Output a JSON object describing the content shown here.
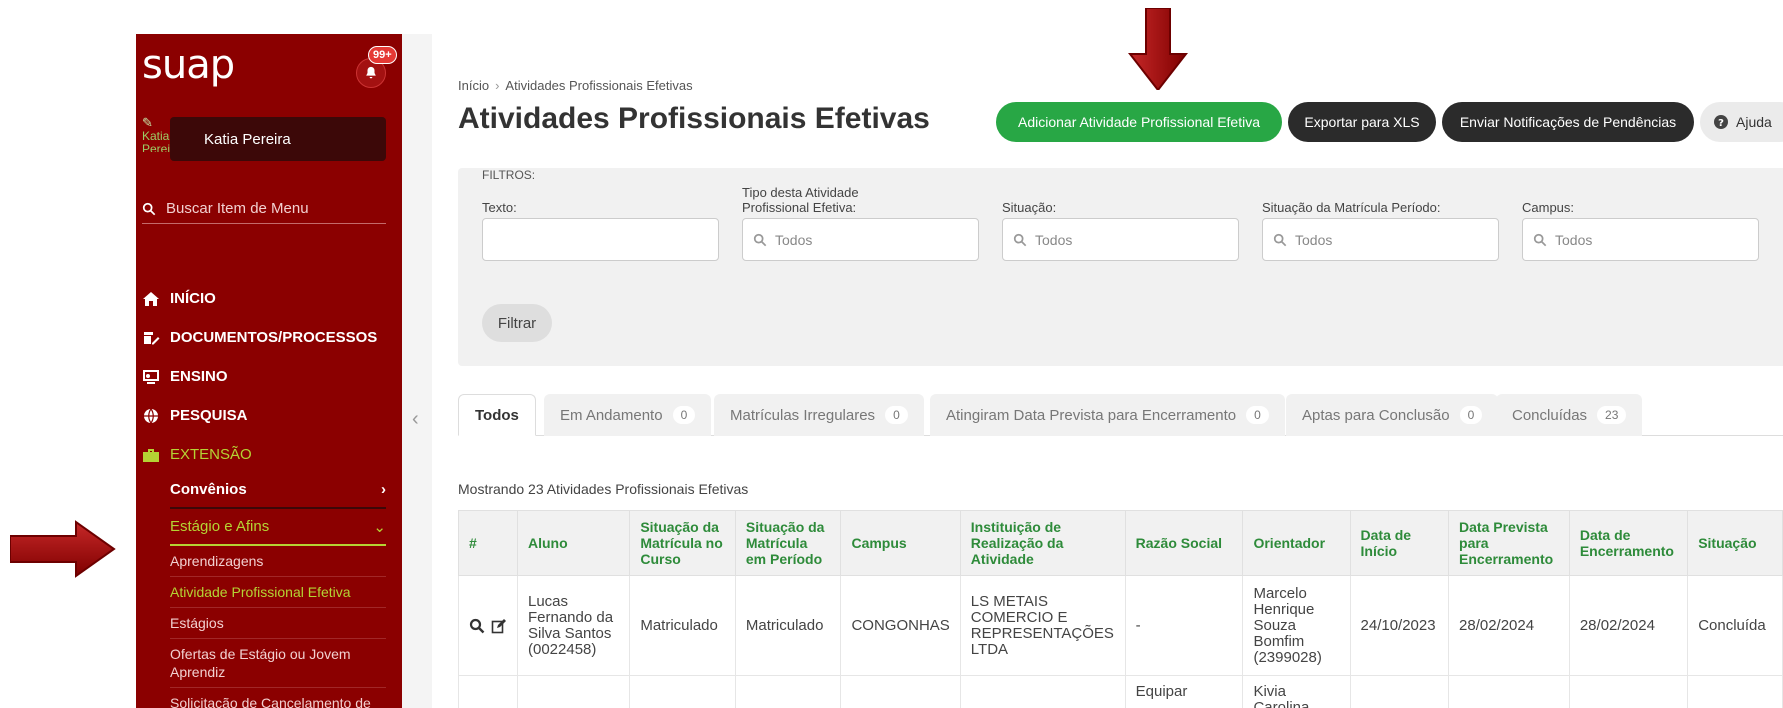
{
  "sidebar": {
    "logo": "suap",
    "notification_badge": "99+",
    "avatar_alt": "Katia Pereir",
    "user_name": "Katia Pereira",
    "search_placeholder": "Buscar Item de Menu",
    "menu": [
      {
        "label": "INÍCIO",
        "icon": "home-icon"
      },
      {
        "label": "DOCUMENTOS/PROCESSOS",
        "icon": "document-edit-icon"
      },
      {
        "label": "ENSINO",
        "icon": "teaching-icon"
      },
      {
        "label": "PESQUISA",
        "icon": "globe-icon"
      },
      {
        "label": "EXTENSÃO",
        "icon": "extension-icon"
      }
    ],
    "submenu": {
      "convenios": "Convênios",
      "estagio": "Estágio e Afins",
      "items": [
        "Aprendizagens",
        "Atividade Profissional Efetiva",
        "Estágios",
        "Ofertas de Estágio ou Jovem Aprendiz",
        "Solicitação de Cancelamento de Encerramento de Estágios e Afins"
      ]
    }
  },
  "breadcrumb": {
    "home": "Início",
    "current": "Atividades Profissionais Efetivas"
  },
  "page_title": "Atividades Profissionais Efetivas",
  "actions": {
    "add": "Adicionar Atividade Profissional Efetiva",
    "export": "Exportar para XLS",
    "notify": "Enviar Notificações de Pendências",
    "help": "Ajuda"
  },
  "filters": {
    "label": "FILTROS:",
    "texto": "Texto:",
    "tipo": "Tipo desta Atividade Profissional Efetiva:",
    "situacao": "Situação:",
    "situacao_matricula": "Situação da Matrícula Período:",
    "campus": "Campus:",
    "placeholder": "Todos",
    "submit": "Filtrar"
  },
  "tabs": [
    {
      "label": "Todos",
      "count": ""
    },
    {
      "label": "Em Andamento",
      "count": "0"
    },
    {
      "label": "Matrículas Irregulares",
      "count": "0"
    },
    {
      "label": "Atingiram Data Prevista para Encerramento",
      "count": "0"
    },
    {
      "label": "Aptas para Conclusão",
      "count": "0"
    },
    {
      "label": "Concluídas",
      "count": "23"
    }
  ],
  "showing_text": "Mostrando 23 Atividades Profissionais Efetivas",
  "table": {
    "headers": [
      "#",
      "Aluno",
      "Situação da Matrícula no Curso",
      "Situação da Matrícula em Período",
      "Campus",
      "Instituição de Realização da Atividade",
      "Razão Social",
      "Orientador",
      "Data de Início",
      "Data Prevista para Encerramento",
      "Data de Encerramento",
      "Situação"
    ],
    "rows": [
      [
        "",
        "Lucas Fernando da Silva Santos (0022458)",
        "Matriculado",
        "Matriculado",
        "CONGONHAS",
        "LS METAIS COMERCIO E REPRESENTAÇÕES LTDA",
        "-",
        "Marcelo Henrique Souza Bomfim (2399028)",
        "24/10/2023",
        "28/02/2024",
        "28/02/2024",
        "Concluída"
      ],
      [
        "",
        "",
        "",
        "",
        "",
        "",
        "Equipar",
        "Kivia Carolina",
        "",
        "",
        "",
        ""
      ]
    ]
  },
  "colors": {
    "sidebar": "#8b0000",
    "accent_green": "#28a745",
    "active_menu": "#b5d334",
    "arrow": "#b71c1c"
  }
}
